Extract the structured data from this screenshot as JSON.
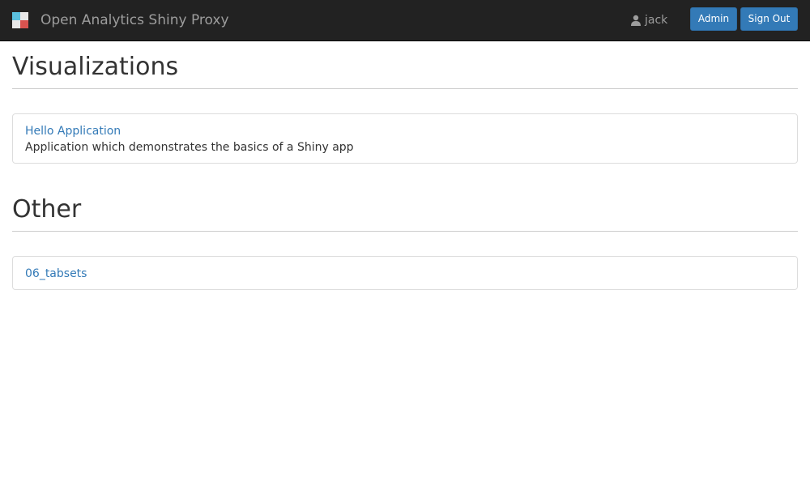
{
  "header": {
    "title": "Open Analytics Shiny Proxy",
    "user": "jack",
    "admin_label": "Admin",
    "signout_label": "Sign Out",
    "logo_colors": [
      "#5bc0de",
      "#e8e8e8",
      "#e8e8e8",
      "#d9534f"
    ]
  },
  "sections": [
    {
      "title": "Visualizations",
      "apps": [
        {
          "name": "Hello Application",
          "description": "Application which demonstrates the basics of a Shiny app"
        }
      ]
    },
    {
      "title": "Other",
      "apps": [
        {
          "name": "06_tabsets"
        }
      ]
    }
  ],
  "colors": {
    "navbar": "#222222",
    "link": "#337ab7",
    "button": "#337ab7"
  }
}
